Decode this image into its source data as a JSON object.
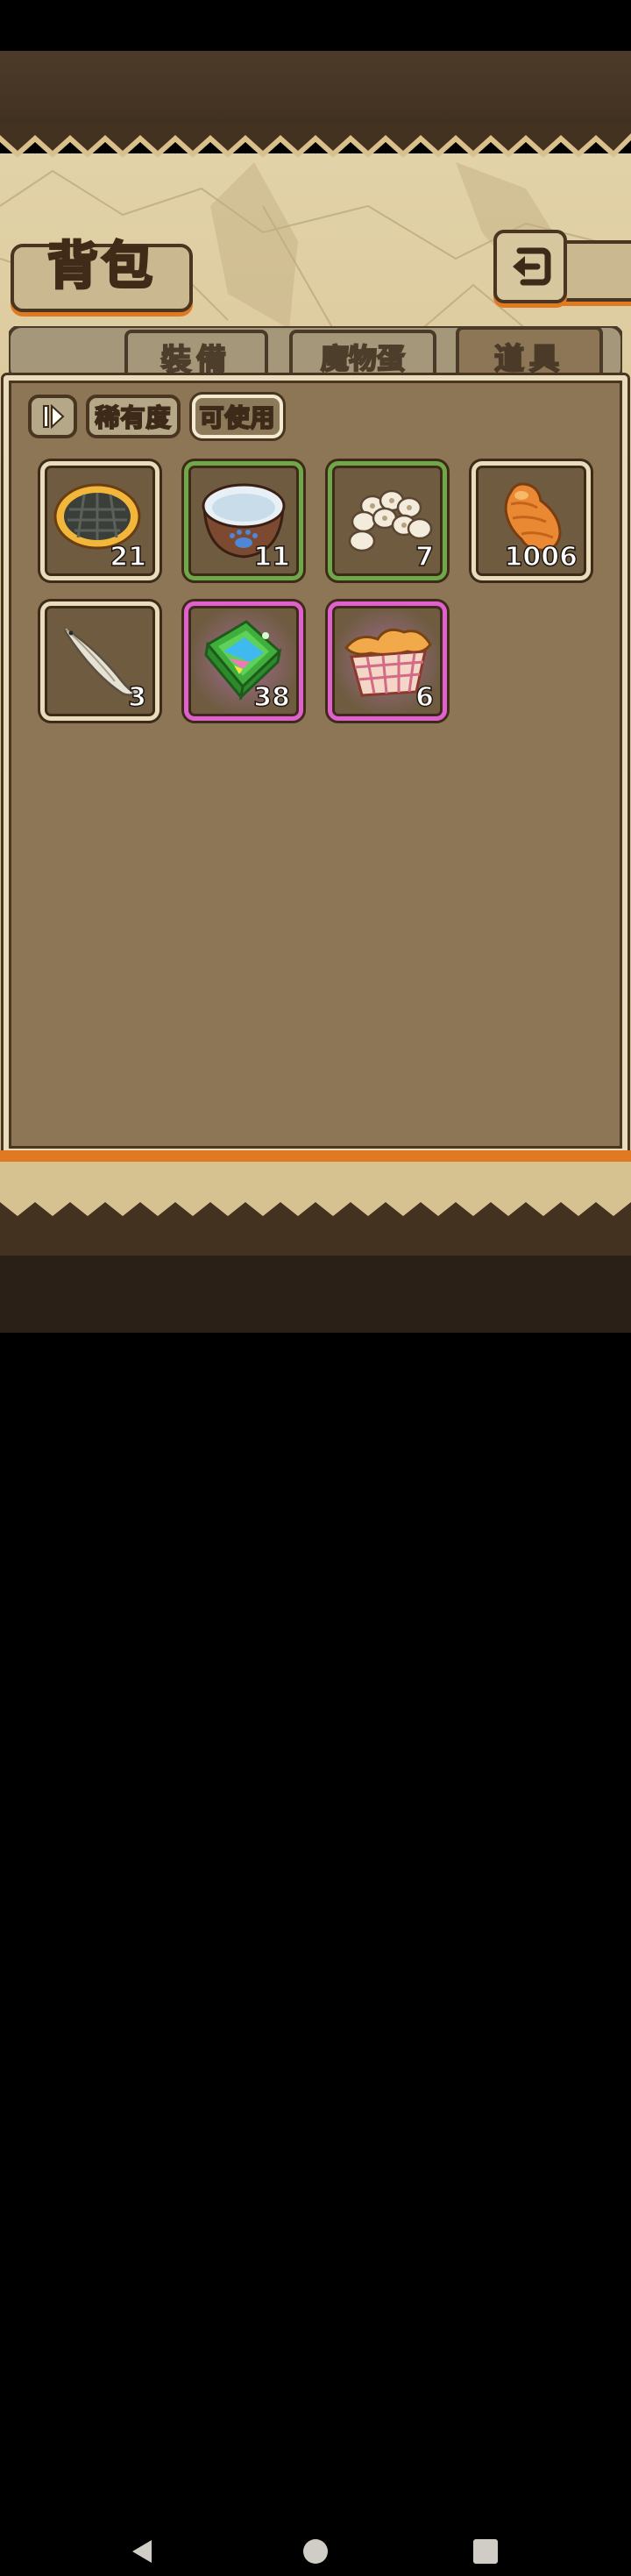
{
  "title": "背包",
  "tabs": [
    {
      "label": "裝備",
      "active": false
    },
    {
      "label": "魔物蛋",
      "active": false
    },
    {
      "label": "道具",
      "active": true
    }
  ],
  "filters": {
    "toggle_icon": "sort-toggle-icon",
    "rarity_label": "稀有度",
    "usable_label": "可使用",
    "selected": "可使用"
  },
  "items": [
    {
      "icon": "grilled-pie-icon",
      "quantity": "21",
      "rarity_color": "#e8dcbc"
    },
    {
      "icon": "water-bowl-icon",
      "quantity": "11",
      "rarity_color": "#6fa84a"
    },
    {
      "icon": "pebbles-icon",
      "quantity": "7",
      "rarity_color": "#6fa84a"
    },
    {
      "icon": "bread-roll-icon",
      "quantity": "1006",
      "rarity_color": "#e8dcbc"
    },
    {
      "icon": "fish-icon",
      "quantity": "3",
      "rarity_color": "#e8dcbc"
    },
    {
      "icon": "rainbow-jelly-icon",
      "quantity": "38",
      "rarity_color": "#e060d0"
    },
    {
      "icon": "bread-basket-icon",
      "quantity": "6",
      "rarity_color": "#e060d0"
    }
  ],
  "colors": {
    "panel": "#8c7655",
    "frame": "#e8dcbc",
    "accent": "#e07a22",
    "common": "#e8dcbc",
    "uncommon": "#6fa84a",
    "rare": "#e060d0"
  },
  "system_nav": [
    "back-icon",
    "home-icon",
    "recents-icon"
  ]
}
